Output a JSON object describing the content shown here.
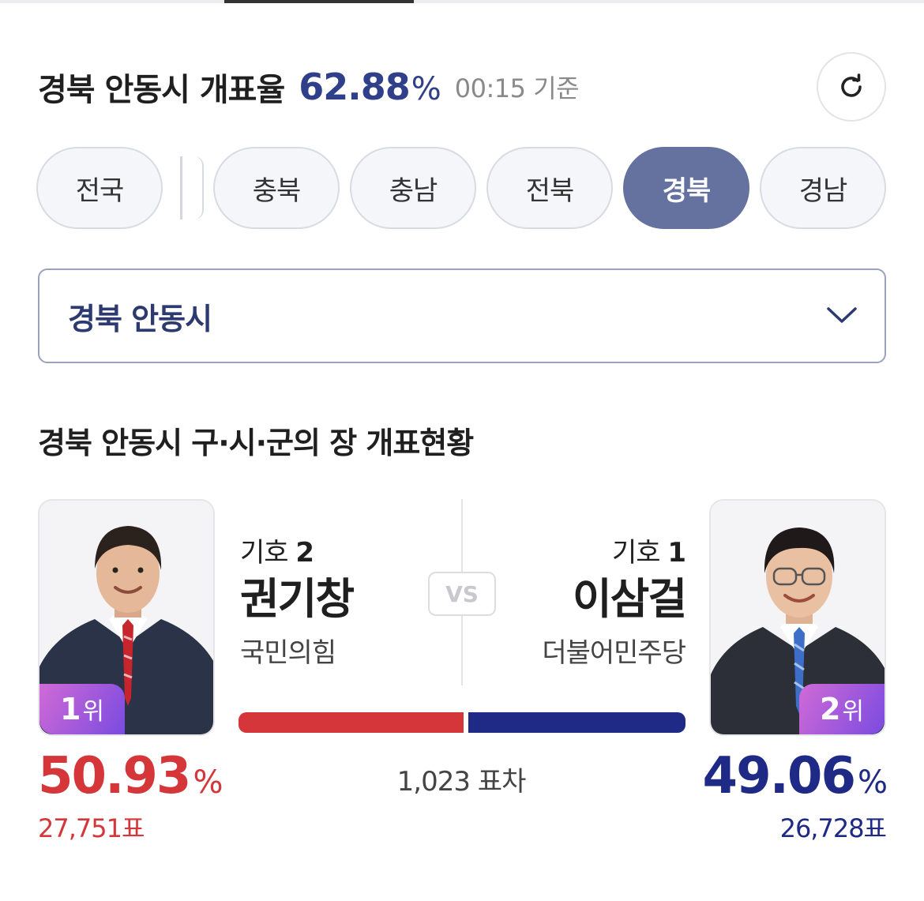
{
  "header": {
    "title": "경북 안동시 개표율",
    "count_rate": "62.88",
    "count_rate_unit": "%",
    "time": "00:15 기준"
  },
  "region_chips": [
    {
      "label": "전국",
      "active": false
    },
    {
      "label": "충북",
      "active": false
    },
    {
      "label": "충남",
      "active": false
    },
    {
      "label": "전북",
      "active": false
    },
    {
      "label": "경북",
      "active": true
    },
    {
      "label": "경남",
      "active": false
    }
  ],
  "region_select": {
    "value": "경북 안동시"
  },
  "section": {
    "title": "경북 안동시 구·시·군의 장 개표현황"
  },
  "vs_label": "VS",
  "candidates": [
    {
      "symbol_label": "기호",
      "symbol_number": "2",
      "name": "권기창",
      "party": "국민의힘",
      "rank_number": "1",
      "rank_suffix": "위",
      "percent": "50.93",
      "percent_unit": "%",
      "votes": "27,751표",
      "share": 0.5093,
      "color": "#d4363a"
    },
    {
      "symbol_label": "기호",
      "symbol_number": "1",
      "name": "이삼걸",
      "party": "더불어민주당",
      "rank_number": "2",
      "rank_suffix": "위",
      "percent": "49.06",
      "percent_unit": "%",
      "votes": "26,728표",
      "share": 0.4906,
      "color": "#1e2a86"
    }
  ],
  "margin_text": "1,023 표차",
  "colors": {
    "accent": "#2f3f8a",
    "active_chip": "#65729f",
    "party_red": "#d4363a",
    "party_blue": "#1e2a86"
  },
  "icons": {
    "refresh": "refresh-icon",
    "dropdown": "chevron-down-icon"
  }
}
